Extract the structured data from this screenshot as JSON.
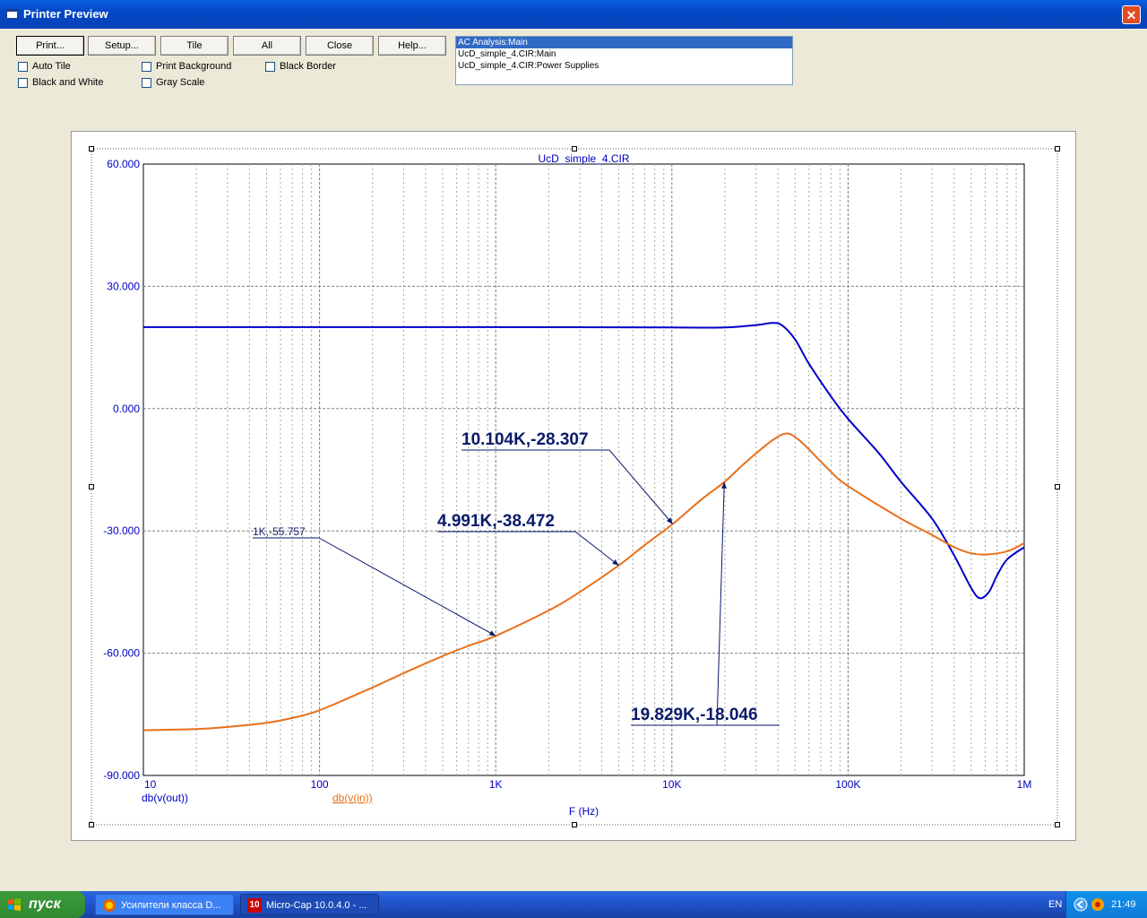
{
  "window": {
    "title": "Printer Preview",
    "close_glyph": "✕"
  },
  "toolbar": {
    "buttons": [
      "Print...",
      "Setup...",
      "Tile",
      "All",
      "Close",
      "Help..."
    ],
    "checkboxes": [
      "Auto Tile",
      "Print Background",
      "Black Border",
      "Black and White",
      "Gray Scale"
    ]
  },
  "pages_list": {
    "items": [
      "AC Analysis:Main",
      "UcD_simple_4.CIR:Main",
      "UcD_simple_4.CIR:Power Supplies"
    ],
    "selected": 0
  },
  "chart_data": {
    "type": "line",
    "title": "UcD_simple_4.CIR",
    "xlabel": "F (Hz)",
    "x_scale": "log",
    "xlim": [
      10,
      1000000
    ],
    "ylim": [
      -90,
      60
    ],
    "x_ticks": [
      "10",
      "100",
      "1K",
      "10K",
      "100K",
      "1M"
    ],
    "y_ticks": [
      "60.000",
      "30.000",
      "0.000",
      "-30.000",
      "-60.000",
      "-90.000"
    ],
    "grid": true,
    "series": [
      {
        "name": "db(v(out))",
        "color": "#0000c8",
        "points": [
          [
            10,
            20
          ],
          [
            100,
            20
          ],
          [
            1000,
            20
          ],
          [
            10000,
            19.9
          ],
          [
            20000,
            19.9
          ],
          [
            30000,
            20.5
          ],
          [
            37000,
            21
          ],
          [
            42000,
            20.5
          ],
          [
            50000,
            17
          ],
          [
            60000,
            11
          ],
          [
            80000,
            3
          ],
          [
            100000,
            -2.5
          ],
          [
            150000,
            -11
          ],
          [
            200000,
            -18
          ],
          [
            300000,
            -27
          ],
          [
            400000,
            -36
          ],
          [
            500000,
            -44
          ],
          [
            560000,
            -46.5
          ],
          [
            630000,
            -45
          ],
          [
            700000,
            -41
          ],
          [
            800000,
            -37
          ],
          [
            1000000,
            -34
          ]
        ]
      },
      {
        "name": "db(v(in))",
        "color": "#e8701a",
        "points": [
          [
            10,
            -78.9
          ],
          [
            20,
            -78.6
          ],
          [
            30,
            -78.1
          ],
          [
            50,
            -77.1
          ],
          [
            70,
            -75.9
          ],
          [
            100,
            -74.0
          ],
          [
            200,
            -68.4
          ],
          [
            300,
            -64.9
          ],
          [
            500,
            -60.7
          ],
          [
            700,
            -58.2
          ],
          [
            1000,
            -55.757
          ],
          [
            2000,
            -49.5
          ],
          [
            3000,
            -45
          ],
          [
            4991,
            -38.472
          ],
          [
            7000,
            -33.5
          ],
          [
            10104,
            -28.307
          ],
          [
            15000,
            -22
          ],
          [
            19829,
            -18.046
          ],
          [
            25000,
            -14
          ],
          [
            30000,
            -11
          ],
          [
            38000,
            -7.5
          ],
          [
            45000,
            -6.1
          ],
          [
            52000,
            -7.5
          ],
          [
            60000,
            -10
          ],
          [
            80000,
            -15.5
          ],
          [
            100000,
            -19
          ],
          [
            200000,
            -27
          ],
          [
            300000,
            -31
          ],
          [
            400000,
            -34
          ],
          [
            500000,
            -35.5
          ],
          [
            600000,
            -35.8
          ],
          [
            800000,
            -35
          ],
          [
            1000000,
            -33
          ]
        ]
      }
    ],
    "annotations": [
      {
        "label": "1K,-55.757",
        "x": 1000,
        "y": -55.757
      },
      {
        "label": "4.991K,-38.472",
        "x": 4991,
        "y": -38.472
      },
      {
        "label": "10.104K,-28.307",
        "x": 10104,
        "y": -28.307
      },
      {
        "label": "19.829K,-18.046",
        "x": 19829,
        "y": -18.046
      }
    ]
  },
  "taskbar": {
    "start_label": "пуск",
    "tasks": [
      "Усилители класса D...",
      "Micro-Cap 10.0.4.0 - ..."
    ],
    "micro_cap_badge": "10",
    "language": "EN",
    "clock": "21:49"
  }
}
